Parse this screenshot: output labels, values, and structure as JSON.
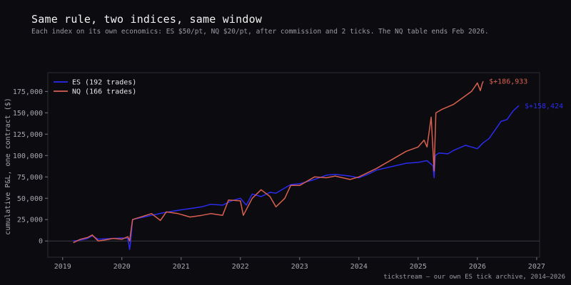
{
  "header": {
    "title": "Same rule, two indices, same window",
    "subtitle": "Each index on its own economics: ES $50/pt, NQ $20/pt, after commission and 2 ticks. The NQ table ends Feb 2026."
  },
  "footer": {
    "source": "tickstream — our own ES tick archive, 2014–2026"
  },
  "colors": {
    "background": "#0c0b10",
    "plot_border": "#2e2d36",
    "es": "#2b2bf0",
    "nq": "#d9604f"
  },
  "chart_data": {
    "type": "line",
    "title": "Same rule, two indices, same window",
    "ylabel": "cumulative P&L, one contract ($)",
    "xlabel": "",
    "xlim": [
      2018.75,
      2027.05
    ],
    "ylim": [
      -19000,
      197000
    ],
    "x_ticks": [
      2019,
      2020,
      2021,
      2022,
      2023,
      2024,
      2025,
      2026,
      2027
    ],
    "x_tick_labels": [
      "2019",
      "2020",
      "2021",
      "2022",
      "2023",
      "2024",
      "2025",
      "2026",
      "2027"
    ],
    "y_ticks": [
      0,
      25000,
      50000,
      75000,
      100000,
      125000,
      150000,
      175000
    ],
    "y_tick_labels": [
      "0",
      "25,000",
      "50,000",
      "75,000",
      "100,000",
      "125,000",
      "150,000",
      "175,000"
    ],
    "grid": false,
    "legend_position": "top-left",
    "series": [
      {
        "name": "ES",
        "legend": "ES  (192 trades)",
        "end_label": "$+158,424",
        "x": [
          2019.18,
          2019.3,
          2019.42,
          2019.5,
          2019.6,
          2019.7,
          2019.85,
          2020.0,
          2020.1,
          2020.13,
          2020.15,
          2020.18,
          2020.5,
          2020.7,
          2020.95,
          2021.15,
          2021.35,
          2021.5,
          2021.7,
          2021.85,
          2022.0,
          2022.1,
          2022.2,
          2022.35,
          2022.5,
          2022.6,
          2022.75,
          2022.85,
          2023.0,
          2023.25,
          2023.45,
          2023.6,
          2023.85,
          2024.0,
          2024.15,
          2024.3,
          2024.55,
          2024.8,
          2025.0,
          2025.15,
          2025.25,
          2025.27,
          2025.29,
          2025.35,
          2025.5,
          2025.6,
          2025.8,
          2026.0,
          2026.1,
          2026.2,
          2026.4,
          2026.5,
          2026.6,
          2026.7
        ],
        "y": [
          0,
          1000,
          3000,
          6000,
          2000,
          2500,
          3000,
          3500,
          3000,
          -10000,
          0,
          25000,
          30000,
          33000,
          36000,
          38000,
          40000,
          43000,
          42000,
          47000,
          50000,
          42000,
          55000,
          52000,
          57000,
          56000,
          62000,
          66000,
          67000,
          72000,
          77000,
          78000,
          76000,
          74000,
          78000,
          83000,
          87000,
          91000,
          92000,
          94000,
          88000,
          74000,
          100000,
          103000,
          102000,
          106000,
          112000,
          108000,
          115000,
          120000,
          140000,
          142000,
          152000,
          158424
        ]
      },
      {
        "name": "NQ",
        "legend": "NQ  (166 trades)",
        "end_label": "$+186,933",
        "x": [
          2019.18,
          2019.3,
          2019.42,
          2019.5,
          2019.6,
          2019.7,
          2019.85,
          2020.0,
          2020.1,
          2020.13,
          2020.18,
          2020.5,
          2020.65,
          2020.75,
          2020.95,
          2021.15,
          2021.35,
          2021.5,
          2021.7,
          2021.8,
          2022.0,
          2022.05,
          2022.2,
          2022.35,
          2022.5,
          2022.6,
          2022.75,
          2022.85,
          2023.0,
          2023.25,
          2023.45,
          2023.6,
          2023.85,
          2024.0,
          2024.15,
          2024.3,
          2024.55,
          2024.8,
          2025.0,
          2025.1,
          2025.15,
          2025.22,
          2025.27,
          2025.3,
          2025.4,
          2025.6,
          2025.8,
          2025.9,
          2025.95,
          2026.0,
          2026.05,
          2026.08,
          2026.1
        ],
        "y": [
          -2000,
          2000,
          4000,
          7000,
          0,
          1000,
          3000,
          2000,
          5000,
          0,
          25000,
          32000,
          24000,
          34000,
          32000,
          28000,
          30000,
          32000,
          30000,
          48000,
          47000,
          30000,
          50000,
          60000,
          52000,
          40000,
          50000,
          65000,
          65000,
          75000,
          74000,
          76000,
          72000,
          75000,
          80000,
          85000,
          95000,
          105000,
          110000,
          118000,
          110000,
          145000,
          82000,
          150000,
          154000,
          160000,
          170000,
          175000,
          180000,
          185000,
          176000,
          184000,
          186933
        ]
      }
    ]
  }
}
